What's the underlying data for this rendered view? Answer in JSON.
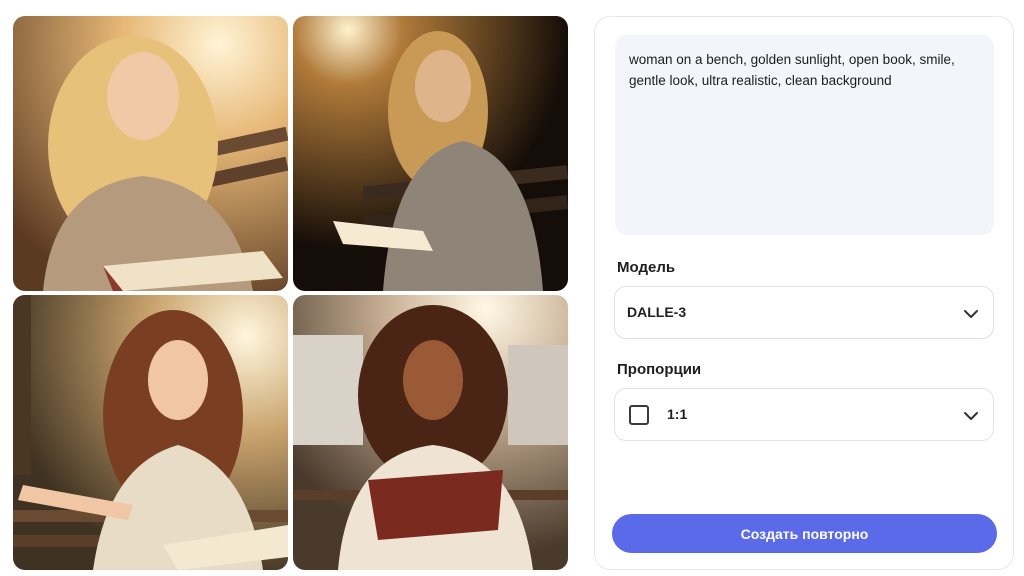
{
  "prompt": {
    "text": "woman on a bench, golden sunlight, open book, smile, gentle look, ultra realistic, clean background"
  },
  "model": {
    "label": "Модель",
    "value": "DALLE-3"
  },
  "ratio": {
    "label": "Пропорции",
    "value": "1:1"
  },
  "actions": {
    "regenerate_label": "Создать повторно"
  },
  "colors": {
    "accent": "#5a6ae8",
    "prompt_bg": "#f4f5fa",
    "border": "#dfe1e7"
  },
  "images": [
    {
      "name": "generated-image-1",
      "icon": "woman-blonde-bench-book"
    },
    {
      "name": "generated-image-2",
      "icon": "woman-backlit-dark-book"
    },
    {
      "name": "generated-image-3",
      "icon": "woman-brunette-bench-book"
    },
    {
      "name": "generated-image-4",
      "icon": "woman-curly-hair-book"
    }
  ]
}
